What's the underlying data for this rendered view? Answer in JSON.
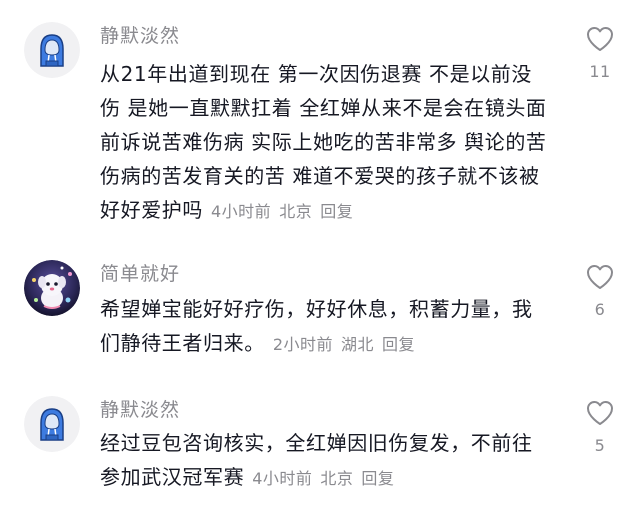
{
  "comments": [
    {
      "username": "静默淡然",
      "avatar": "blue-hoodie-avatar",
      "text": "从21年出道到现在 第一次因伤退赛 不是以前没伤 是她一直默默扛着 全红婵从来不是会在镜头面前诉说苦难伤病 实际上她吃的苦非常多 舆论的苦伤病的苦发育关的苦 难道不爱哭的孩子就不该被好好爱护吗",
      "time": "4小时前",
      "location": "北京",
      "reply_label": "回复",
      "likes": "11"
    },
    {
      "username": "简单就好",
      "avatar": "cartoon-dog-avatar",
      "text": "希望婵宝能好好疗伤，好好休息，积蓄力量，我们静待王者归来。",
      "time": "2小时前",
      "location": "湖北",
      "reply_label": "回复",
      "likes": "6"
    },
    {
      "username": "静默淡然",
      "avatar": "blue-hoodie-avatar",
      "text": "经过豆包咨询核实，全红婵因旧伤复发，不前往参加武汉冠军赛",
      "time": "4小时前",
      "location": "北京",
      "reply_label": "回复",
      "likes": "5"
    }
  ],
  "colors": {
    "text": "#161823",
    "meta": "#8a8a8f",
    "hoodie": "#3d7be0"
  }
}
